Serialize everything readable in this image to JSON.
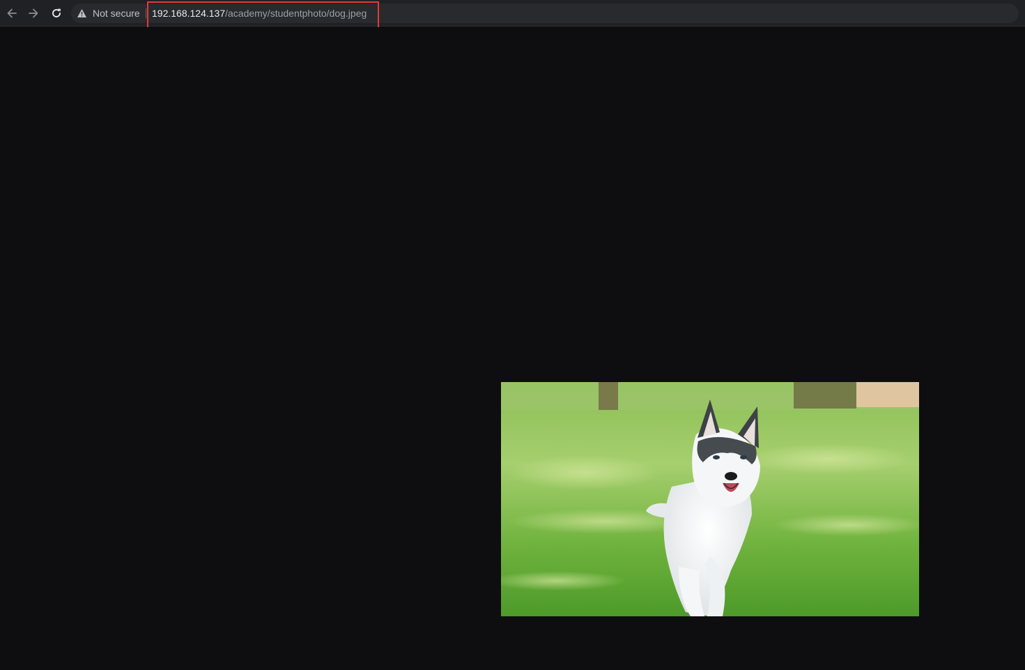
{
  "browser": {
    "nav": {
      "back_icon": "arrow-left-icon",
      "forward_icon": "arrow-right-icon",
      "reload_icon": "reload-icon"
    },
    "omnibox": {
      "security_label": "Not secure",
      "security_icon": "warning-triangle-icon",
      "url_host": "192.168.124.137",
      "url_path": "/academy/studentphoto/dog.jpeg"
    },
    "annotation": {
      "highlight_color": "#e53935"
    }
  },
  "page": {
    "background": "#0e0e10",
    "image": {
      "subject": "husky running on grass",
      "file": "dog.jpeg"
    }
  }
}
